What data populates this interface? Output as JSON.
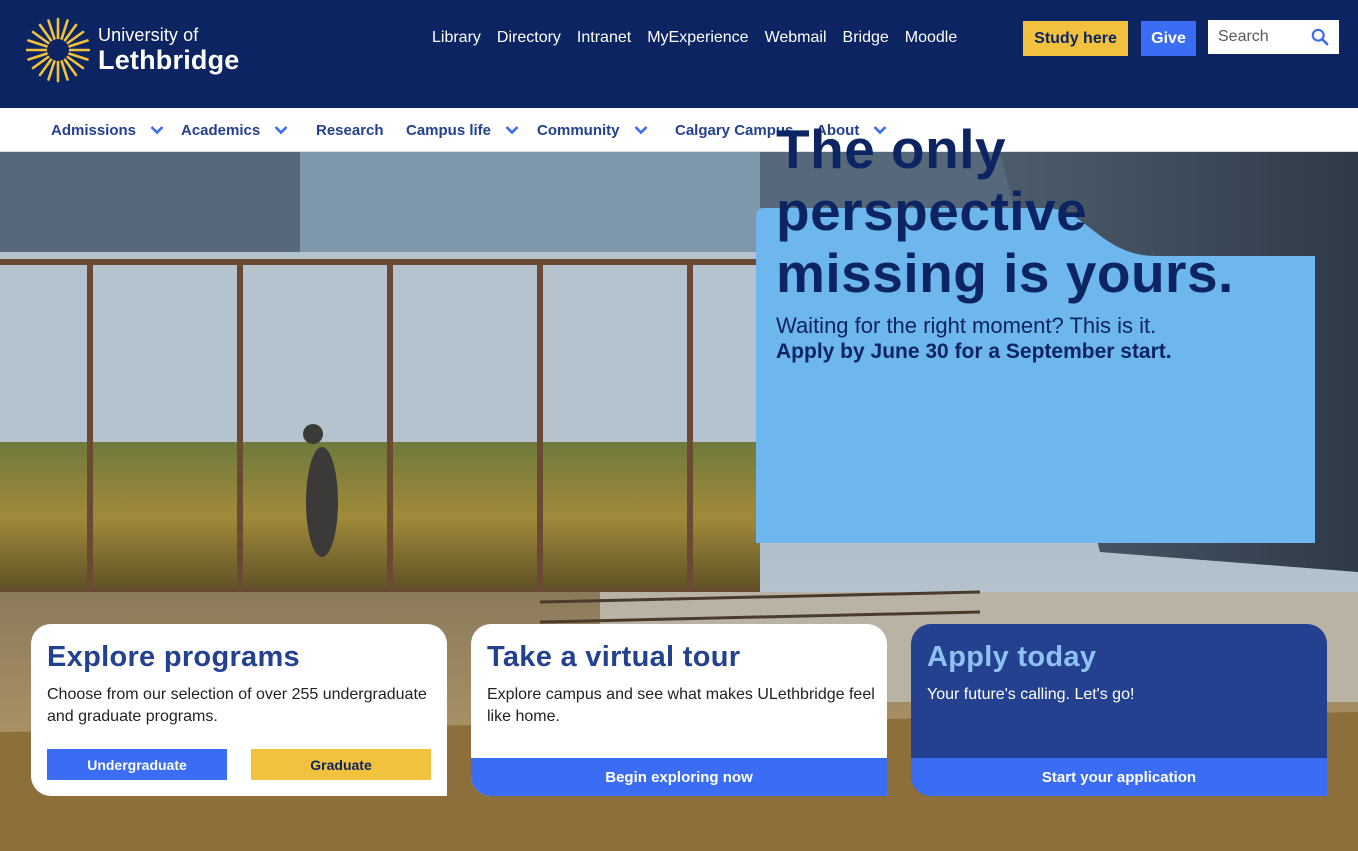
{
  "header": {
    "logo_line1": "University of",
    "logo_line2": "Lethbridge",
    "util_links": [
      "Library",
      "Directory",
      "Intranet",
      "MyExperience",
      "Webmail",
      "Bridge",
      "Moodle"
    ],
    "study_label": "Study here",
    "give_label": "Give",
    "search_placeholder": "Search",
    "icons": [
      "sunburst-logo-icon",
      "search-icon"
    ]
  },
  "mainnav": {
    "items": [
      {
        "label": "Admissions",
        "dropdown": true
      },
      {
        "label": "Academics",
        "dropdown": true
      },
      {
        "label": "Research",
        "dropdown": false
      },
      {
        "label": "Campus life",
        "dropdown": true
      },
      {
        "label": "Community",
        "dropdown": true
      },
      {
        "label": "Calgary Campus",
        "dropdown": false
      },
      {
        "label": "About",
        "dropdown": true
      }
    ]
  },
  "hero": {
    "headline": "The only perspective missing is yours.",
    "subline": "Waiting for the right moment? This is it.",
    "strong": "Apply by June 30 for a September start."
  },
  "cards": {
    "programs": {
      "title": "Explore programs",
      "text": "Choose from our selection of over 255 undergraduate and graduate programs.",
      "btn_undergrad": "Undergraduate",
      "btn_grad": "Graduate"
    },
    "tour": {
      "title": "Take a virtual tour",
      "text": "Explore campus and see what makes ULethbridge feel like home.",
      "cta": "Begin exploring now"
    },
    "apply": {
      "title": "Apply today",
      "text": "Your future's calling. Let's go!",
      "cta": "Start your application"
    }
  },
  "colors": {
    "navy": "#0c2461",
    "nav_text": "#24418f",
    "accent_blue": "#3a6cf4",
    "gold": "#f2c23e",
    "callout_bg": "#6db6ee"
  }
}
